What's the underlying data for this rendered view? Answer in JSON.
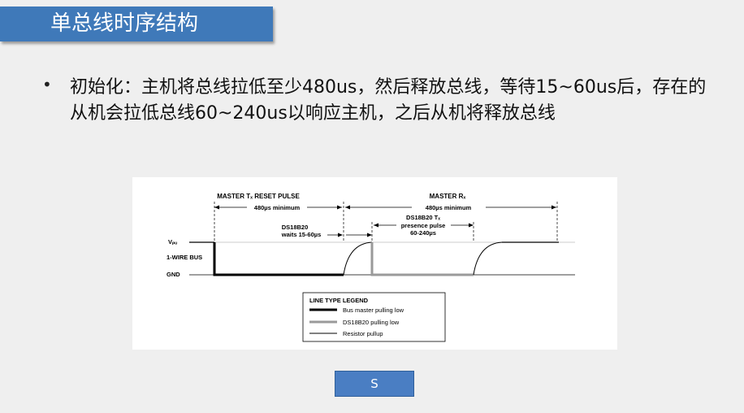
{
  "slide": {
    "title": "单总线时序结构",
    "bullet_text": "初始化：主机将总线拉低至少480us，然后释放总线，等待15~60us后，存在的从机会拉低总线60~240us以响应主机，之后从机将释放总线",
    "button_label": "S"
  },
  "diagram": {
    "master_tx_label": "MASTER Tₓ RESET PULSE",
    "master_rx_label": "MASTER Rₓ",
    "min_480_left": "480µs minimum",
    "min_480_right": "480µs minimum",
    "ds_wait_line1": "DS18B20",
    "ds_wait_line2": "waits 15-60µs",
    "ds_tx_line1": "DS18B20 Tₓ",
    "ds_tx_line2": "presence pulse",
    "ds_tx_line3": "60-240µs",
    "vpu_label": "Vₚᵤ",
    "bus_label": "1-WIRE BUS",
    "gnd_label": "GND",
    "legend_title": "LINE TYPE LEGEND",
    "legend_master": "Bus master pulling low",
    "legend_ds": "DS18B20 pulling low",
    "legend_resistor": "Resistor pullup",
    "colors": {
      "master": "#000000",
      "ds18b20": "#9a9a9a",
      "pullup": "#000000"
    }
  }
}
